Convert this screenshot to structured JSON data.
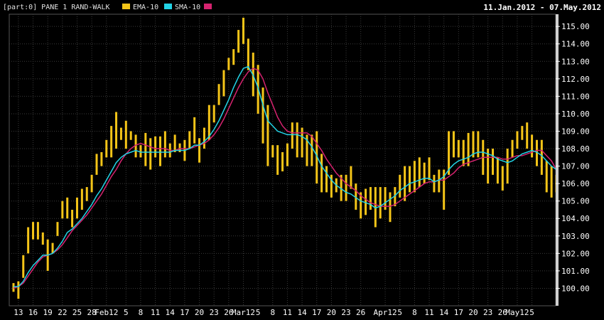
{
  "header": {
    "pane_label": "[part:0] PANE 1 RAND-WALK",
    "legend": [
      {
        "label": "EMA-10",
        "color": "#f5c518"
      },
      {
        "label": "SMA-10",
        "color": "#22d3e6"
      },
      {
        "label": "",
        "color": "#d6236f"
      }
    ],
    "date_range": "11.Jan.2012 - 07.May.2012"
  },
  "colors": {
    "background": "#000000",
    "grid": "#3a3a3a",
    "bars": "#f5c518",
    "ema": "#22d3e6",
    "sma": "#d6236f",
    "axis_panel": "#cfcfcf"
  },
  "chart_data": {
    "type": "line",
    "title": "",
    "xlabel": "",
    "ylabel": "",
    "ylim": [
      99.0,
      115.7
    ],
    "grid": true,
    "legend_position": "top-left",
    "y_ticks": [
      "100.00",
      "101.00",
      "102.00",
      "103.00",
      "104.00",
      "105.00",
      "106.00",
      "107.00",
      "108.00",
      "109.00",
      "110.00",
      "111.00",
      "112.00",
      "113.00",
      "114.00",
      "115.00"
    ],
    "x_tick_labels": [
      "13",
      "16",
      "19",
      "22",
      "25",
      "28",
      "Feb12",
      "5",
      "8",
      "11",
      "14",
      "17",
      "20",
      "23",
      "26",
      "Mar12",
      "5",
      "8",
      "11",
      "14",
      "17",
      "20",
      "23",
      "26",
      "Apr12",
      "5",
      "8",
      "11",
      "14",
      "17",
      "20",
      "23",
      "26",
      "May12",
      "5"
    ],
    "x_tick_index": [
      1,
      4,
      7,
      10,
      13,
      16,
      19,
      23,
      26,
      29,
      32,
      35,
      38,
      41,
      44,
      47,
      50,
      53,
      56,
      59,
      62,
      65,
      68,
      71,
      76,
      79,
      82,
      85,
      88,
      91,
      94,
      97,
      100,
      103,
      106
    ],
    "bars": {
      "name": "RAND-WALK",
      "low": [
        99.8,
        99.4,
        100.6,
        102.0,
        102.8,
        102.8,
        102.5,
        101.0,
        102.0,
        103.0,
        104.0,
        104.0,
        103.5,
        104.0,
        104.5,
        105.0,
        105.5,
        106.5,
        107.0,
        107.5,
        107.5,
        108.0,
        108.5,
        108.0,
        108.5,
        107.5,
        107.5,
        107.0,
        106.8,
        107.5,
        107.0,
        107.5,
        107.5,
        107.8,
        107.8,
        107.3,
        108.0,
        108.3,
        107.2,
        108.0,
        108.5,
        109.5,
        110.5,
        111.0,
        112.5,
        112.8,
        113.5,
        114.0,
        112.5,
        111.0,
        110.0,
        108.3,
        107.0,
        107.5,
        106.5,
        106.7,
        107.0,
        108.0,
        107.5,
        107.5,
        107.0,
        107.0,
        106.0,
        105.5,
        105.5,
        105.2,
        105.5,
        105.0,
        105.0,
        105.7,
        104.5,
        104.0,
        104.2,
        104.5,
        103.5,
        104.0,
        104.5,
        103.8,
        104.7,
        105.2,
        105.0,
        105.5,
        105.5,
        105.8,
        106.0,
        106.2,
        105.5,
        105.5,
        104.5,
        106.5,
        107.5,
        107.5,
        107.0,
        107.0,
        107.5,
        107.5,
        106.5,
        106.0,
        106.5,
        106.0,
        105.6,
        106.0,
        107.5,
        108.0,
        108.5,
        108.0,
        107.5,
        107.0,
        106.5,
        105.5,
        105.2,
        105.5
      ],
      "high": [
        100.3,
        100.4,
        101.9,
        103.5,
        103.8,
        103.8,
        103.2,
        102.8,
        102.6,
        103.8,
        105.0,
        105.2,
        104.5,
        105.2,
        105.7,
        105.8,
        106.5,
        107.7,
        107.8,
        108.5,
        109.3,
        110.1,
        109.2,
        109.6,
        109.0,
        108.8,
        108.2,
        108.9,
        108.6,
        108.7,
        108.7,
        109.0,
        108.3,
        108.8,
        108.3,
        108.5,
        109.0,
        109.8,
        108.6,
        109.2,
        110.5,
        110.5,
        111.7,
        112.5,
        113.2,
        113.7,
        114.8,
        115.5,
        114.3,
        113.5,
        112.8,
        111.5,
        110.5,
        108.2,
        108.2,
        107.8,
        108.3,
        109.5,
        109.5,
        109.2,
        108.8,
        108.8,
        109.0,
        107.7,
        107.0,
        106.5,
        106.3,
        106.5,
        106.5,
        107.0,
        106.0,
        105.5,
        105.7,
        105.8,
        105.8,
        105.8,
        105.8,
        105.5,
        105.8,
        106.5,
        107.0,
        107.0,
        107.3,
        107.5,
        107.2,
        107.5,
        106.5,
        106.8,
        106.8,
        109.0,
        109.0,
        108.5,
        108.5,
        108.9,
        109.0,
        109.0,
        108.5,
        108.0,
        108.0,
        107.5,
        107.0,
        108.0,
        108.5,
        109.0,
        109.3,
        109.5,
        108.8,
        108.5,
        108.5,
        107.3,
        107.0,
        106.5
      ]
    },
    "series": [
      {
        "name": "EMA-10",
        "values": [
          100.1,
          100.1,
          100.4,
          100.9,
          101.3,
          101.6,
          101.9,
          101.9,
          102.0,
          102.3,
          102.7,
          103.2,
          103.4,
          103.7,
          104.0,
          104.4,
          104.8,
          105.3,
          105.7,
          106.2,
          106.7,
          107.2,
          107.5,
          107.7,
          107.8,
          107.9,
          107.8,
          107.8,
          107.8,
          107.8,
          107.8,
          107.8,
          107.8,
          107.9,
          107.9,
          107.9,
          108.0,
          108.2,
          108.2,
          108.4,
          108.7,
          109.1,
          109.6,
          110.2,
          110.8,
          111.5,
          112.1,
          112.6,
          112.7,
          112.2,
          111.5,
          110.5,
          109.6,
          109.3,
          109.0,
          108.9,
          108.8,
          108.8,
          108.8,
          108.7,
          108.5,
          108.1,
          107.6,
          107.0,
          106.6,
          106.2,
          105.9,
          105.7,
          105.5,
          105.4,
          105.2,
          105.0,
          104.9,
          104.8,
          104.6,
          104.7,
          104.9,
          105.1,
          105.3,
          105.6,
          105.8,
          106.0,
          106.1,
          106.2,
          106.3,
          106.3,
          106.1,
          106.2,
          106.4,
          106.8,
          107.1,
          107.3,
          107.4,
          107.5,
          107.7,
          107.8,
          107.8,
          107.7,
          107.6,
          107.4,
          107.3,
          107.2,
          107.3,
          107.5,
          107.7,
          107.8,
          107.9,
          107.8,
          107.6,
          107.3,
          107.0,
          106.8
        ]
      },
      {
        "name": "",
        "values": [
          100.0,
          100.1,
          100.3,
          100.7,
          101.1,
          101.5,
          101.8,
          101.9,
          102.0,
          102.2,
          102.5,
          102.9,
          103.3,
          103.6,
          103.9,
          104.2,
          104.6,
          105.0,
          105.4,
          105.9,
          106.4,
          106.8,
          107.3,
          107.7,
          108.0,
          108.2,
          108.3,
          108.2,
          108.1,
          108.0,
          108.0,
          108.0,
          107.9,
          107.9,
          108.0,
          108.0,
          108.0,
          108.1,
          108.2,
          108.3,
          108.5,
          108.8,
          109.2,
          109.7,
          110.3,
          110.9,
          111.5,
          112.0,
          112.4,
          112.6,
          112.5,
          112.0,
          111.2,
          110.5,
          109.8,
          109.3,
          109.0,
          108.9,
          108.9,
          108.9,
          108.9,
          108.7,
          108.3,
          107.9,
          107.4,
          107.0,
          106.6,
          106.3,
          106.0,
          105.8,
          105.6,
          105.3,
          105.1,
          104.9,
          104.8,
          104.7,
          104.7,
          104.7,
          104.8,
          105.0,
          105.2,
          105.4,
          105.6,
          105.8,
          106.0,
          106.1,
          106.1,
          106.2,
          106.2,
          106.4,
          106.6,
          106.9,
          107.1,
          107.2,
          107.3,
          107.4,
          107.5,
          107.5,
          107.5,
          107.5,
          107.4,
          107.4,
          107.5,
          107.6,
          107.6,
          107.7,
          107.8,
          107.9,
          107.9,
          107.6,
          107.3,
          106.8
        ]
      }
    ]
  }
}
